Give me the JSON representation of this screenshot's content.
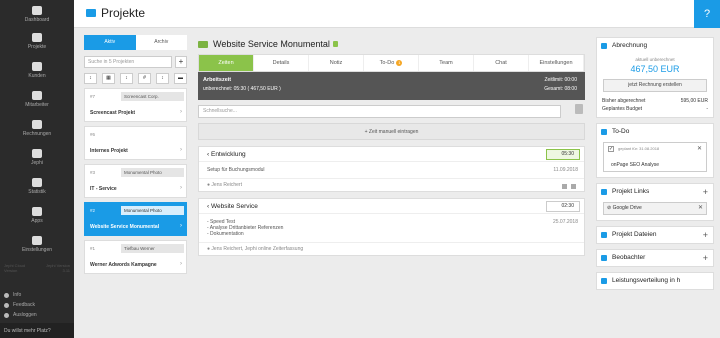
{
  "sidebar": {
    "items": [
      {
        "label": "Dashboard",
        "icon": "dashboard-icon"
      },
      {
        "label": "Projekte",
        "icon": "folder-icon"
      },
      {
        "label": "Kunden",
        "icon": "building-icon"
      },
      {
        "label": "Mitarbeiter",
        "icon": "users-icon"
      },
      {
        "label": "Rechnungen",
        "icon": "invoice-icon"
      },
      {
        "label": "Jephi",
        "icon": "eye-icon"
      },
      {
        "label": "Statistik",
        "icon": "pie-chart-icon"
      },
      {
        "label": "Apps",
        "icon": "puzzle-icon"
      },
      {
        "label": "Einstellungen",
        "icon": "gear-icon"
      }
    ],
    "meta_left": "Jephi Cloud",
    "meta_right": "Jephi Version",
    "meta_line2_left": "Version",
    "meta_line2_right": "3.11",
    "links": [
      "Info",
      "Feedback",
      "Ausloggen"
    ],
    "bottom": "Du willst mehr Platz?"
  },
  "header": {
    "title": "Projekte"
  },
  "project_list": {
    "tab_active": "Aktiv",
    "tab_archive": "Archiv",
    "search_placeholder": "Suche in 5 Projekten",
    "cards": [
      {
        "num": "#7",
        "customer": "Screencast Corp.",
        "name": "Screencast Projekt",
        "active": false
      },
      {
        "num": "#6",
        "customer": "",
        "name": "Internes Projekt",
        "active": false
      },
      {
        "num": "#3",
        "customer": "Monumental Photo",
        "name": "IT - Service",
        "active": false
      },
      {
        "num": "#2",
        "customer": "Monumental Photo",
        "name": "Website Service Monumental",
        "active": true
      },
      {
        "num": "#1",
        "customer": "Tiefbau Werner",
        "name": "Werner Adwords Kampagne",
        "active": false
      }
    ]
  },
  "main": {
    "project_title": "Website Service Monumental",
    "tabs": [
      {
        "label": "Zeiten",
        "active": true
      },
      {
        "label": "Details"
      },
      {
        "label": "Notiz"
      },
      {
        "label": "To-Do",
        "badge": "1"
      },
      {
        "label": "Team"
      },
      {
        "label": "Chat"
      },
      {
        "label": "Einstellungen"
      }
    ],
    "worktime_label": "Arbeitszeit",
    "unbilled": "unberechnet: 05:30  ( 467,50 EUR )",
    "total_time": "Zeitlimit: 00:00",
    "total_sum": "Gesamt: 08:00",
    "search_placeholder": "Schnellsuche...",
    "add_time": "+ Zeit manuell eintragen",
    "entries": [
      {
        "title": "Entwicklung",
        "duration": "05:30",
        "date": "11.09.2018",
        "body": [
          "Setup für Buchungsmodul"
        ],
        "footer": "Jens Reichert"
      },
      {
        "title": "Website Service",
        "duration": "02:30",
        "date": "25.07.2018",
        "body": [
          "- Speed Test",
          "- Analyse Drittanbieter Referenzen",
          "- Dokumentation"
        ],
        "footer": "Jens Reichert, Jephi online Zeiterfassung"
      }
    ]
  },
  "right": {
    "billing": {
      "title": "Abrechnung",
      "amount_label": "aktuell unberechnet",
      "amount": "467,50 EUR",
      "button": "jetzt Rechnung erstellen",
      "rows": [
        {
          "k": "Bisher abgerechnet",
          "v": "595,00 EUR"
        },
        {
          "k": "Geplantes Budget",
          "v": "-"
        }
      ]
    },
    "todo": {
      "title": "To-Do",
      "meta": "geplant für: 31.08.2018",
      "text": "onPage SEO Analyse"
    },
    "links": {
      "title": "Projekt Links",
      "chip": "Google Drive"
    },
    "files": {
      "title": "Projekt Dateien"
    },
    "observers": {
      "title": "Beobachter"
    },
    "distribution": {
      "title": "Leistungsverteilung in h"
    }
  }
}
